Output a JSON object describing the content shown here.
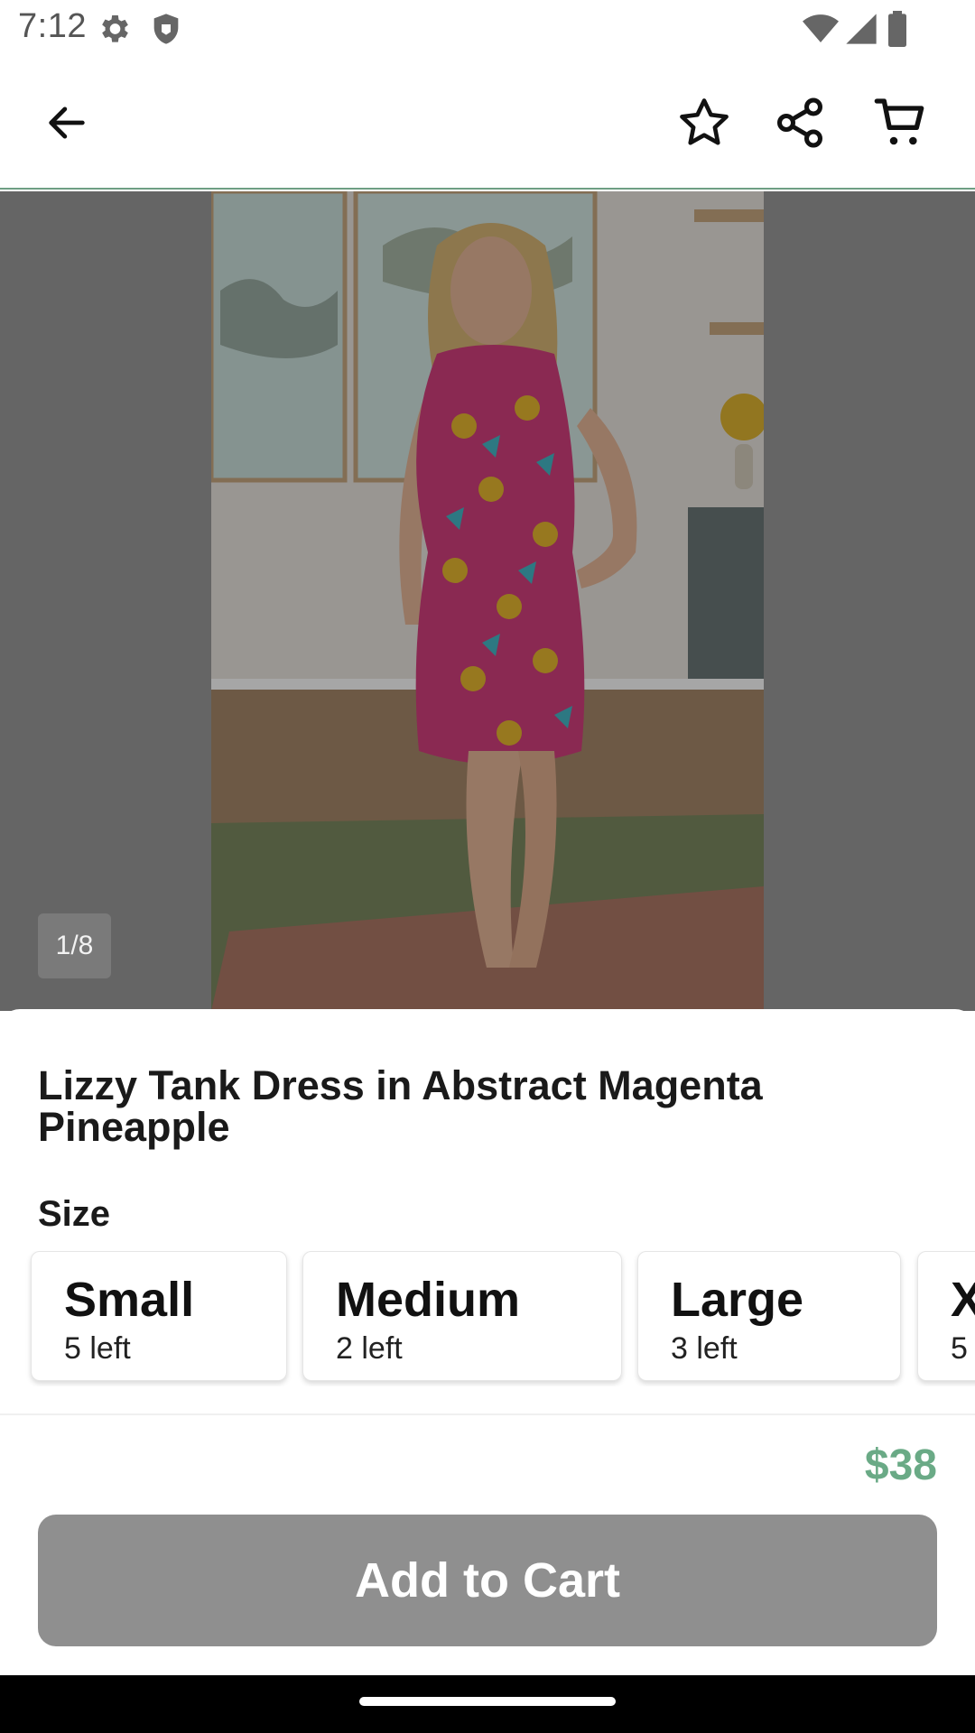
{
  "status_bar": {
    "time": "7:12",
    "icons": [
      "gear-icon",
      "shield-icon",
      "wifi-icon",
      "signal-icon",
      "battery-icon"
    ]
  },
  "app_bar": {
    "back_icon": "arrow-left-icon",
    "actions": [
      "star-icon",
      "share-icon",
      "cart-icon"
    ]
  },
  "gallery": {
    "counter": "1/8"
  },
  "product": {
    "title": "Lizzy Tank Dress in Abstract Magenta Pineapple",
    "size_label": "Size",
    "sizes": [
      {
        "name": "Small",
        "stock": "5 left"
      },
      {
        "name": "Medium",
        "stock": "2 left"
      },
      {
        "name": "Large",
        "stock": "3 left"
      },
      {
        "name": "X",
        "stock": "5"
      }
    ]
  },
  "footer": {
    "price": "$38",
    "add_to_cart_label": "Add to Cart"
  },
  "colors": {
    "accent": "#6aaa86",
    "button_disabled": "#8f8f8f"
  }
}
